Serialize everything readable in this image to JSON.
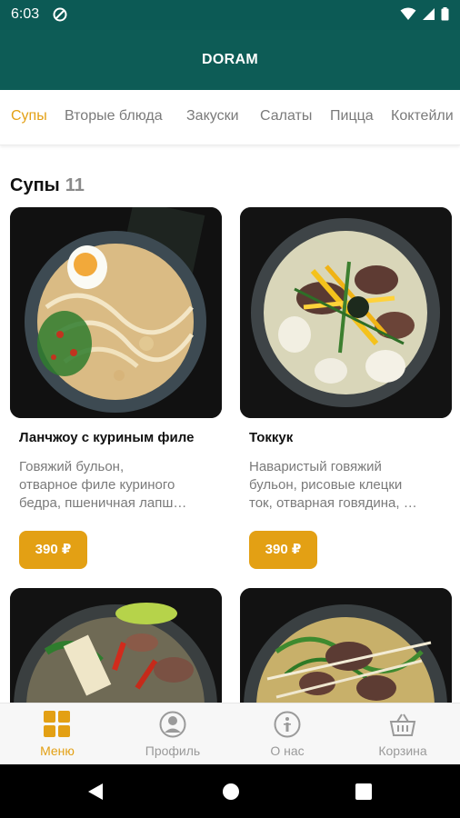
{
  "status_bar": {
    "time": "6:03"
  },
  "app_bar": {
    "title": "DORAM"
  },
  "tabs": [
    {
      "label": "Супы",
      "active": true
    },
    {
      "label": "Вторые блюда"
    },
    {
      "label": "Закуски"
    },
    {
      "label": "Салаты"
    },
    {
      "label": "Пицца"
    },
    {
      "label": "Коктейли"
    }
  ],
  "section": {
    "title": "Супы",
    "count": "11"
  },
  "products": [
    {
      "name": "Ланчжоу с куриным филе",
      "description_lines": [
        "Говяжий бульон,",
        "отварное филе куриного",
        "бедра, пшеничная лапш…"
      ],
      "price": "390 ₽"
    },
    {
      "name": "Токкук",
      "description_lines": [
        "Наваристый говяжий",
        "бульон, рисовые клецки",
        "ток, отварная говядина, …"
      ],
      "price": "390 ₽"
    },
    {
      "name": "",
      "description_lines": [],
      "price": ""
    },
    {
      "name": "",
      "description_lines": [],
      "price": ""
    }
  ],
  "bottom_nav": [
    {
      "label": "Меню",
      "icon": "grid-icon",
      "active": true
    },
    {
      "label": "Профиль",
      "icon": "profile-icon"
    },
    {
      "label": "О нас",
      "icon": "info-icon"
    },
    {
      "label": "Корзина",
      "icon": "basket-icon"
    }
  ],
  "colors": {
    "primary": "#0d5c56",
    "accent": "#e3a014",
    "inactive": "#9a9a9a"
  }
}
